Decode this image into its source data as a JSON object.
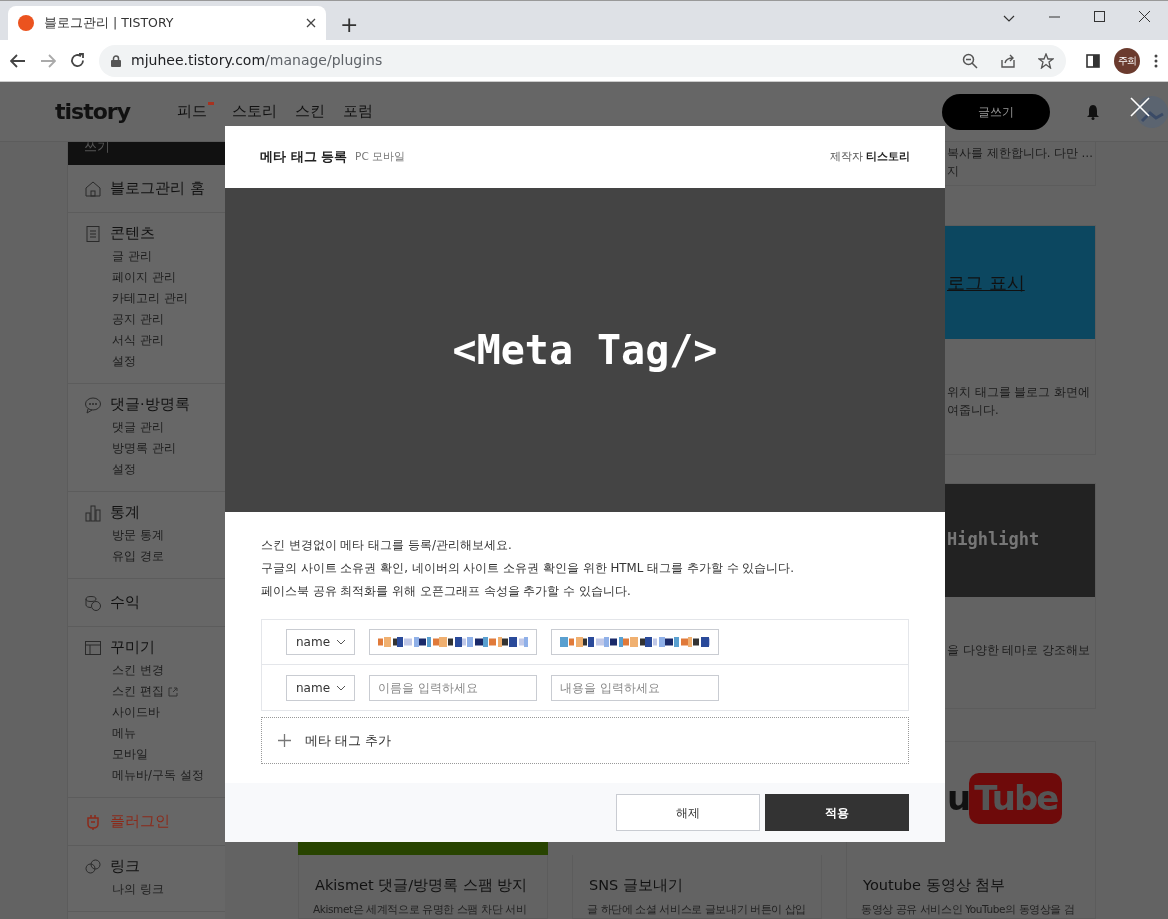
{
  "browser": {
    "tab_title": "블로그관리 | TISTORY",
    "new_tab": "+",
    "url_host": "mjuhee.tistory.com",
    "url_path": "/manage/plugins",
    "profile": "주희"
  },
  "header": {
    "logo": "tistory",
    "nav": [
      {
        "label": "피드",
        "badge": true
      },
      {
        "label": "스토리",
        "badge": false
      },
      {
        "label": "스킨",
        "badge": false
      },
      {
        "label": "포럼",
        "badge": false
      }
    ],
    "write_button": "글쓰기"
  },
  "sidebar": {
    "write_button": "쓰기",
    "sections": [
      {
        "title": "블로그관리 홈",
        "selected": false
      },
      {
        "title": "콘텐츠",
        "selected": false,
        "items": [
          {
            "label": "글 관리",
            "external": false
          },
          {
            "label": "페이지 관리",
            "external": false
          },
          {
            "label": "카테고리 관리",
            "external": false
          },
          {
            "label": "공지 관리",
            "external": false
          },
          {
            "label": "서식 관리",
            "external": false
          },
          {
            "label": "설정",
            "external": false
          }
        ]
      },
      {
        "title": "댓글·방명록",
        "selected": false,
        "items": [
          {
            "label": "댓글 관리",
            "external": false
          },
          {
            "label": "방명록 관리",
            "external": false
          },
          {
            "label": "설정",
            "external": false
          }
        ]
      },
      {
        "title": "통계",
        "selected": false,
        "items": [
          {
            "label": "방문 통계",
            "external": false
          },
          {
            "label": "유입 경로",
            "external": false
          }
        ]
      },
      {
        "title": "수익",
        "selected": false
      },
      {
        "title": "꾸미기",
        "selected": false,
        "items": [
          {
            "label": "스킨 변경",
            "external": false
          },
          {
            "label": "스킨 편집",
            "external": true
          },
          {
            "label": "사이드바",
            "external": false
          },
          {
            "label": "메뉴",
            "external": false
          },
          {
            "label": "모바일",
            "external": false
          },
          {
            "label": "메뉴바/구독 설정",
            "external": false
          }
        ]
      },
      {
        "title": "플러그인",
        "selected": true
      },
      {
        "title": "링크",
        "selected": false,
        "items": [
          {
            "label": "나의 링크",
            "external": false
          }
        ]
      }
    ]
  },
  "plugin_fragments": {
    "card_a_lines": [
      "복사를 제한합니다. 다만 …",
      "지"
    ],
    "card_b_link": "로그 표시",
    "card_b_lines": [
      "위치 태그를 블로그 화면에",
      "여줍니다."
    ],
    "card_c_banner": "Highlight",
    "card_c_lines": [
      "을 다양한 테마로 강조해보"
    ],
    "card_d_logo_left": "u",
    "card_d_logo_right": "Tube"
  },
  "plugin_cards": [
    {
      "title": "Akismet 댓글/방명록 스팸 방지",
      "description": "Akismet은 세계적으로 유명한 스팸 차단 서비"
    },
    {
      "title": "SNS 글보내기",
      "description": "글 하단에 소셜 서비스로 글보내기 버튼이 삽입"
    },
    {
      "title": "Youtube 동영상 첨부",
      "description": "동영상 공유 서비스인 YouTube의 동영상을 검"
    }
  ],
  "modal": {
    "title": "메타 태그 등록",
    "platforms": "PC 모바일",
    "maker_label": "제작자",
    "maker": "티스토리",
    "banner_text": "<Meta Tag/>",
    "description": [
      "스킨 변경없이 메타 태그를 등록/관리해보세요.",
      "구글의 사이트 소유권 확인, 네이버의 사이트 소유권 확인을 위한 HTML 태그를 추가할 수 있습니다.",
      "페이스북 공유 최적화를 위해 오픈그래프 속성을 추가할 수 있습니다."
    ],
    "rows": [
      {
        "kind": "filled",
        "select_value": "name"
      },
      {
        "kind": "empty",
        "select_value": "name",
        "name_placeholder": "이름을 입력하세요",
        "content_placeholder": "내용을 입력하세요"
      }
    ],
    "add_label": "메타 태그 추가",
    "buttons": [
      {
        "label": "해제",
        "primary": false
      },
      {
        "label": "적용",
        "primary": true
      }
    ]
  }
}
